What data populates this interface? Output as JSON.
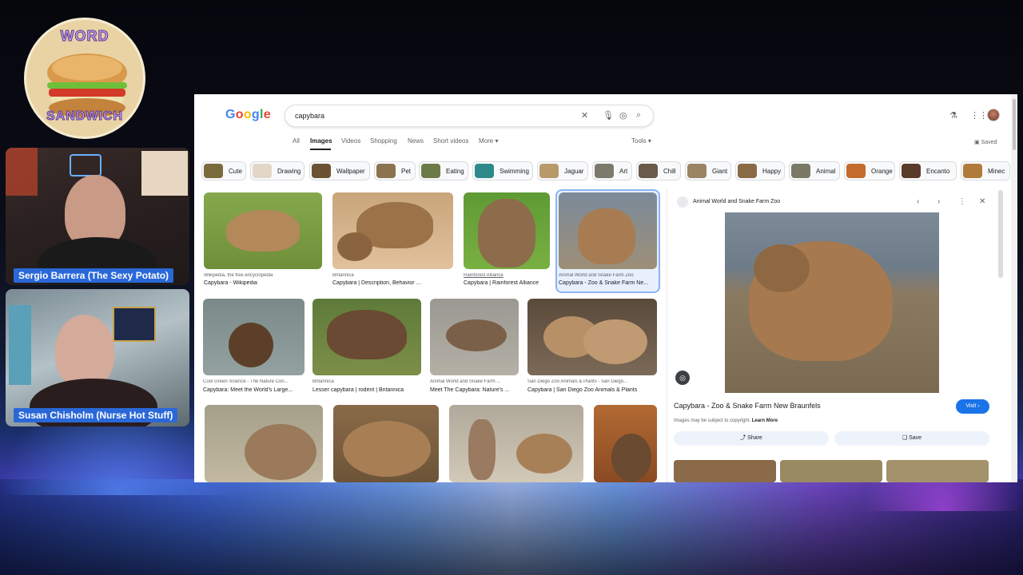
{
  "stream": {
    "logo": {
      "top_text": "WORD",
      "bottom_text": "SANDWICH"
    },
    "cams": [
      {
        "name": "Sergio Barrera (The Sexy Potato)"
      },
      {
        "name": "Susan Chisholm (Nurse Hot Stuff)"
      }
    ]
  },
  "browser": {
    "logo": {
      "letters": [
        "G",
        "o",
        "o",
        "g",
        "l",
        "e"
      ],
      "colors": [
        "#4285f4",
        "#ea4335",
        "#fbbc05",
        "#4285f4",
        "#34a853",
        "#ea4335"
      ]
    },
    "search": {
      "query": "capybara"
    },
    "nav": {
      "tabs": [
        "All",
        "Images",
        "Videos",
        "Shopping",
        "News",
        "Short videos",
        "More ▾"
      ],
      "active": "Images",
      "tools": "Tools ▾",
      "saved": "Saved"
    },
    "chips": [
      "Cute",
      "Drawing",
      "Wallpaper",
      "Pet",
      "Eating",
      "Swimming",
      "Jaguar",
      "Art",
      "Chill",
      "Giant",
      "Happy",
      "Animal",
      "Orange",
      "Encanto",
      "Minec"
    ],
    "results": [
      {
        "source": "Wikipedia, the free encyclopedia",
        "title": "Capybara - Wikipedia"
      },
      {
        "source": "Britannica",
        "title": "Capybara | Description, Behavior ..."
      },
      {
        "source": "Rainforest Alliance",
        "title": "Capybara | Rainforest Alliance"
      },
      {
        "source": "Animal World and Snake Farm Zoo",
        "title": "Capybara - Zoo & Snake Farm Ne..."
      },
      {
        "source": "Cool Green Science - The Nature Con...",
        "title": "Capybara: Meet the World's Large..."
      },
      {
        "source": "Britannica",
        "title": "Lesser capybara | rodent | Britannica"
      },
      {
        "source": "Animal World and Snake Farm ...",
        "title": "Meet The Capybara: Nature's ..."
      },
      {
        "source": "San Diego Zoo Animals & Plants - San Diego...",
        "title": "Capybara | San Diego Zoo Animals & Plants"
      }
    ],
    "panel": {
      "source": "Animal World and Snake Farm Zoo",
      "title": "Capybara - Zoo & Snake Farm New Braunfels",
      "visit": "Visit ›",
      "copyright": "Images may be subject to copyright.",
      "learn_more": "Learn More",
      "share": "Share",
      "save": "Save"
    }
  }
}
